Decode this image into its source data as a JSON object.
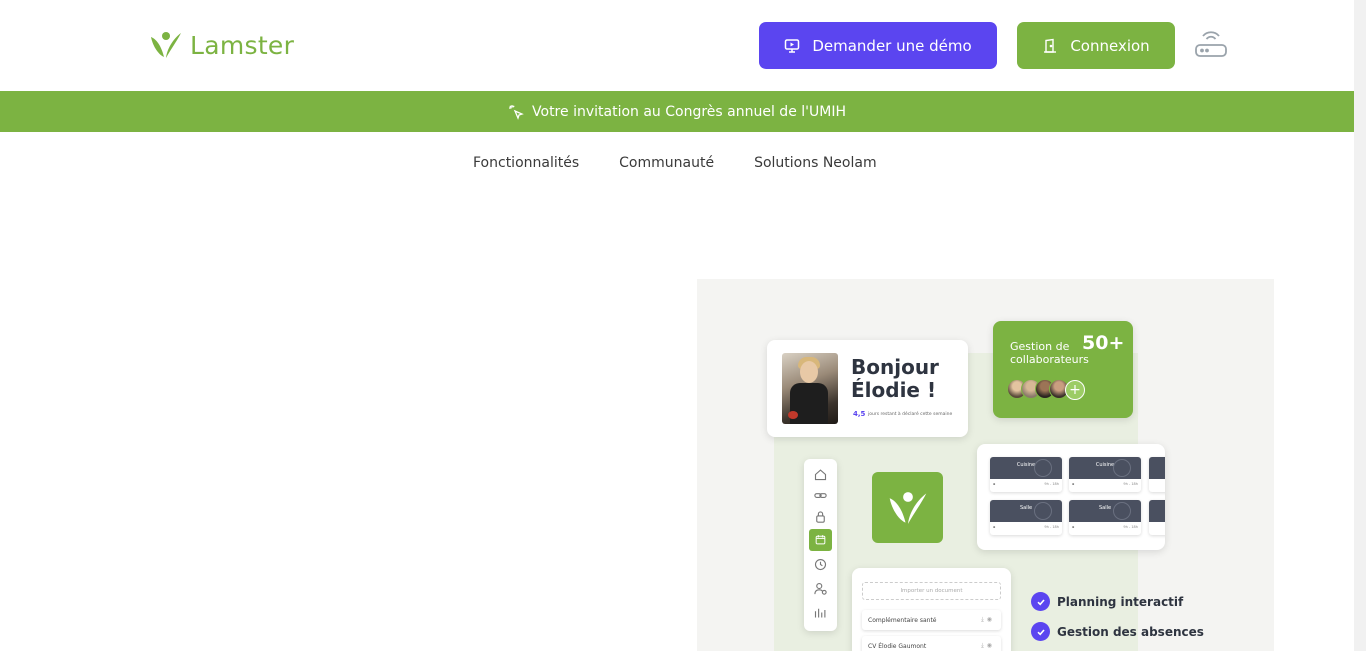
{
  "brand": {
    "name": "Lamster",
    "color": "#7cb342"
  },
  "header": {
    "demo_label": "Demander une démo",
    "demo_color": "#5b45f0",
    "login_label": "Connexion",
    "router_icon": "router-icon"
  },
  "banner": {
    "text": "Votre invitation au Congrès annuel de l'UMIH",
    "icon": "sparkle-pointer-icon"
  },
  "nav": {
    "items": [
      "Fonctionnalités",
      "Communauté",
      "Solutions Neolam"
    ]
  },
  "hero": {
    "greeting": "Bonjour Élodie !",
    "days_value": "4,5",
    "days_text": "jours restant à déclaré cette semaine",
    "collab_label": "Gestion de collaborateurs",
    "collab_count": "50+",
    "planning_tiles": [
      {
        "title": "Cuisine",
        "sub": "9h - 18h"
      },
      {
        "title": "Cuisine",
        "sub": "9h - 18h"
      },
      {
        "title": "Salle",
        "sub": "9h - 18h"
      },
      {
        "title": "Salle",
        "sub": "9h - 18h"
      }
    ],
    "docs": {
      "import_label": "Importer un document",
      "rows": [
        "Complémentaire santé",
        "CV Élodie Gaumont"
      ]
    },
    "features": [
      "Planning interactif",
      "Gestion des absences"
    ]
  }
}
